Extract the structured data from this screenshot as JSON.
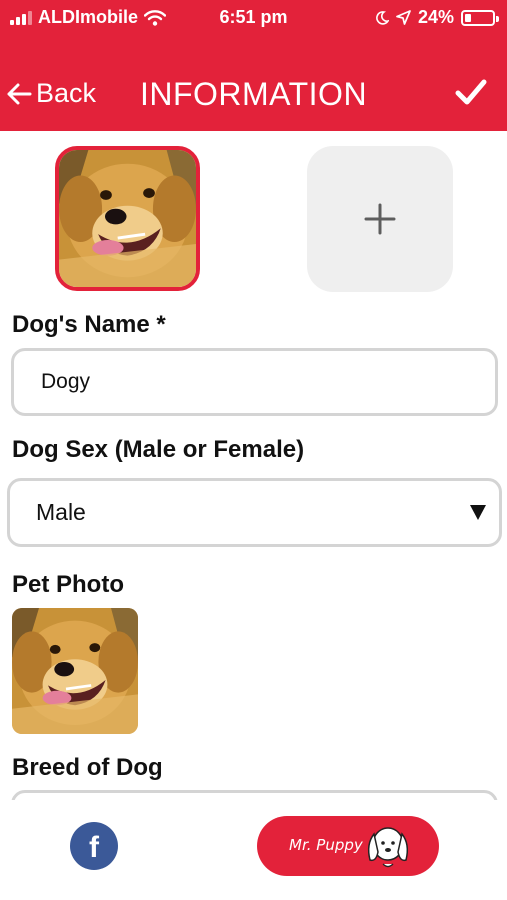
{
  "status_bar": {
    "carrier": "ALDImobile",
    "time": "6:51 pm",
    "battery_percent": "24%",
    "battery_level": 0.24
  },
  "nav": {
    "back_label": "Back",
    "title": "INFORMATION"
  },
  "form": {
    "name_label": "Dog's Name *",
    "name_value": "Dogy",
    "sex_label": "Dog Sex (Male or Female)",
    "sex_value": "Male",
    "pet_photo_label": "Pet Photo",
    "breed_label": "Breed of Dog"
  },
  "footer": {
    "facebook_letter": "f",
    "brand_label": "Mr. Puppy"
  },
  "colors": {
    "accent": "#e3223a",
    "facebook": "#3b5998",
    "field_border": "#d4d4d4",
    "add_tile": "#efefef"
  },
  "icons": [
    "signal-icon",
    "wifi-icon",
    "moon-icon",
    "location-icon",
    "battery-icon",
    "back-arrow-icon",
    "checkmark-icon",
    "plus-icon",
    "dropdown-arrow-icon",
    "facebook-icon",
    "puppy-icon"
  ]
}
